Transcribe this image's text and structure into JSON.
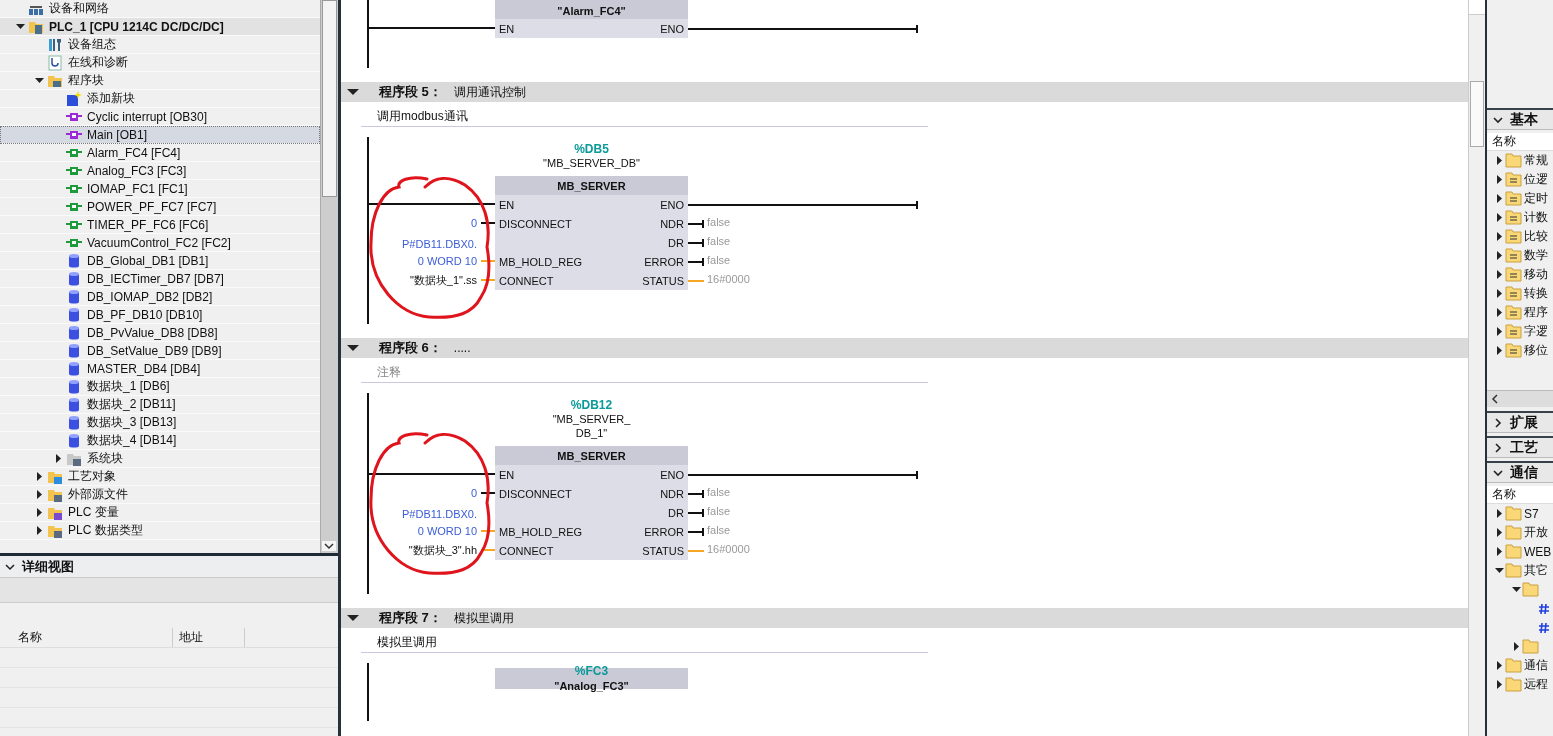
{
  "project_tree": {
    "items": [
      {
        "label": "设备和网络",
        "kind": "network",
        "selected": false
      },
      {
        "label": "PLC_1 [CPU 1214C DC/DC/DC]",
        "kind": "plc",
        "selected": false,
        "expanded": true,
        "children": [
          {
            "label": "设备组态",
            "kind": "config",
            "selected": false
          },
          {
            "label": "在线和诊断",
            "kind": "diag",
            "selected": false
          },
          {
            "label": "程序块",
            "kind": "folder",
            "selected": false,
            "expanded": true,
            "children": [
              {
                "label": "添加新块",
                "kind": "add",
                "selected": false
              },
              {
                "label": "Cyclic interrupt [OB30]",
                "kind": "ob",
                "selected": false
              },
              {
                "label": "Main [OB1]",
                "kind": "ob",
                "selected": true
              },
              {
                "label": "Alarm_FC4 [FC4]",
                "kind": "fc",
                "selected": false
              },
              {
                "label": "Analog_FC3 [FC3]",
                "kind": "fc",
                "selected": false
              },
              {
                "label": "IOMAP_FC1 [FC1]",
                "kind": "fc",
                "selected": false
              },
              {
                "label": "POWER_PF_FC7 [FC7]",
                "kind": "fc",
                "selected": false
              },
              {
                "label": "TIMER_PF_FC6 [FC6]",
                "kind": "fc",
                "selected": false
              },
              {
                "label": "VacuumControl_FC2 [FC2]",
                "kind": "fc",
                "selected": false
              },
              {
                "label": "DB_Global_DB1 [DB1]",
                "kind": "db",
                "selected": false
              },
              {
                "label": "DB_IECTimer_DB7 [DB7]",
                "kind": "db",
                "selected": false
              },
              {
                "label": "DB_IOMAP_DB2 [DB2]",
                "kind": "db",
                "selected": false
              },
              {
                "label": "DB_PF_DB10 [DB10]",
                "kind": "db",
                "selected": false
              },
              {
                "label": "DB_PvValue_DB8 [DB8]",
                "kind": "db",
                "selected": false
              },
              {
                "label": "DB_SetValue_DB9 [DB9]",
                "kind": "db",
                "selected": false
              },
              {
                "label": "MASTER_DB4 [DB4]",
                "kind": "db",
                "selected": false
              },
              {
                "label": "数据块_1 [DB6]",
                "kind": "db",
                "selected": false
              },
              {
                "label": "数据块_2 [DB11]",
                "kind": "db",
                "selected": false
              },
              {
                "label": "数据块_3 [DB13]",
                "kind": "db",
                "selected": false
              },
              {
                "label": "数据块_4 [DB14]",
                "kind": "db",
                "selected": false
              },
              {
                "label": "系统块",
                "kind": "sysfolder",
                "selected": false,
                "expanded": false
              }
            ]
          },
          {
            "label": "工艺对象",
            "kind": "techfolder",
            "selected": false,
            "expanded": false
          },
          {
            "label": "外部源文件",
            "kind": "extfolder",
            "selected": false,
            "expanded": false
          },
          {
            "label": "PLC 变量",
            "kind": "tagfolder",
            "selected": false,
            "expanded": false
          },
          {
            "label": "PLC 数据类型",
            "kind": "typefolder",
            "selected": false,
            "expanded": false
          }
        ]
      }
    ]
  },
  "detail_view": {
    "title": "详细视图",
    "expanded": true,
    "columns": [
      "名称",
      "地址"
    ]
  },
  "editor": {
    "networks": [
      {
        "block": {
          "kind": "fc",
          "name": "\"Alarm_FC4\"",
          "rows": [
            {
              "kind": "enable",
              "in": "EN",
              "out": "ENO"
            }
          ]
        }
      },
      {
        "header": "程序段 5：",
        "title": "调用通讯控制",
        "expanded": true,
        "comment": "调用modbus通讯",
        "annotated": true,
        "block": {
          "kind": "fb",
          "instance": "%DB5",
          "name_lines": [
            "\"MB_SERVER_DB\""
          ],
          "type": "MB_SERVER",
          "rows": [
            {
              "kind": "enable",
              "in": "EN",
              "out": "ENO"
            },
            {
              "kind": "pin",
              "in": "DISCONNECT",
              "in_word": false,
              "in_value": [
                "0"
              ],
              "constant": true,
              "out": "NDR",
              "out_word": false,
              "out_value": "false"
            },
            {
              "kind": "pin",
              "out": "DR",
              "out_word": false,
              "out_value": "false"
            },
            {
              "kind": "pin",
              "in": "MB_HOLD_REG",
              "in_word": true,
              "in_value": [
                "P#DB11.DBX0.",
                "0 WORD 10"
              ],
              "constant": true,
              "out": "ERROR",
              "out_word": false,
              "out_value": "false"
            },
            {
              "kind": "pin",
              "in": "CONNECT",
              "in_word": true,
              "in_value": [
                "\"数据块_1\".ss"
              ],
              "constant": false,
              "out": "STATUS",
              "out_word": true,
              "out_value": "16#0000"
            }
          ]
        }
      },
      {
        "header": "程序段 6：",
        "title": ".....",
        "expanded": true,
        "comment_placeholder": "注释",
        "annotated": true,
        "block": {
          "kind": "fb",
          "instance": "%DB12",
          "name_lines": [
            "\"MB_SERVER_",
            "DB_1\""
          ],
          "type": "MB_SERVER",
          "rows": [
            {
              "kind": "enable",
              "in": "EN",
              "out": "ENO"
            },
            {
              "kind": "pin",
              "in": "DISCONNECT",
              "in_word": false,
              "in_value": [
                "0"
              ],
              "constant": true,
              "out": "NDR",
              "out_word": false,
              "out_value": "false"
            },
            {
              "kind": "pin",
              "out": "DR",
              "out_word": false,
              "out_value": "false"
            },
            {
              "kind": "pin",
              "in": "MB_HOLD_REG",
              "in_word": true,
              "in_value": [
                "P#DB11.DBX0.",
                "0 WORD 10"
              ],
              "constant": true,
              "out": "ERROR",
              "out_word": false,
              "out_value": "false"
            },
            {
              "kind": "pin",
              "in": "CONNECT",
              "in_word": true,
              "in_value": [
                "\"数据块_3\".hh"
              ],
              "constant": false,
              "out": "STATUS",
              "out_word": true,
              "out_value": "16#0000"
            }
          ]
        }
      },
      {
        "header": "程序段 7：",
        "title": "模拟里调用",
        "expanded": true,
        "comment": "模拟里调用",
        "annotated": false,
        "block": {
          "kind": "fc",
          "instance": "%FC3",
          "name": "\"Analog_FC3\""
        }
      }
    ]
  },
  "instructions_panel": {
    "sections": [
      {
        "title": "基本",
        "expanded": true,
        "column": "名称",
        "items": [
          {
            "label": "常规",
            "kind": "folder",
            "expanded": false
          },
          {
            "label": "位逻",
            "kind": "bit",
            "expanded": false
          },
          {
            "label": "定时",
            "kind": "timer",
            "expanded": false
          },
          {
            "label": "计数",
            "kind": "counter",
            "expanded": false
          },
          {
            "label": "比较",
            "kind": "compare",
            "expanded": false
          },
          {
            "label": "数学",
            "kind": "math",
            "expanded": false
          },
          {
            "label": "移动",
            "kind": "move",
            "expanded": false
          },
          {
            "label": "转换",
            "kind": "convert",
            "expanded": false
          },
          {
            "label": "程序",
            "kind": "program",
            "expanded": false
          },
          {
            "label": "字逻",
            "kind": "word",
            "expanded": false
          },
          {
            "label": "移位",
            "kind": "shift",
            "expanded": false
          }
        ]
      },
      {
        "title": "扩展",
        "expanded": false
      },
      {
        "title": "工艺",
        "expanded": false
      },
      {
        "title": "通信",
        "expanded": true,
        "column": "名称",
        "items": [
          {
            "label": "S7",
            "kind": "folder",
            "expanded": false
          },
          {
            "label": "开放",
            "kind": "folder",
            "expanded": false
          },
          {
            "label": "WEB",
            "kind": "folder",
            "expanded": false
          },
          {
            "label": "其它",
            "kind": "folder",
            "expanded": true,
            "children": [
              {
                "kind": "folder",
                "expanded": true,
                "children": [
                  {
                    "kind": "instruction"
                  },
                  {
                    "kind": "instruction"
                  }
                ]
              },
              {
                "kind": "folder",
                "expanded": false
              }
            ]
          },
          {
            "label": "通信",
            "kind": "folder",
            "expanded": false
          },
          {
            "label": "远程",
            "kind": "folder",
            "expanded": false
          }
        ]
      }
    ]
  }
}
